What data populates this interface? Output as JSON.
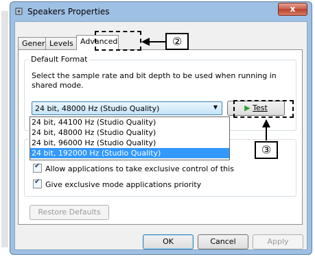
{
  "window": {
    "title": "Speakers Properties",
    "close_glyph": "x"
  },
  "tabs": [
    "General",
    "Levels",
    "Advanced"
  ],
  "default_format": {
    "legend": "Default Format",
    "description": "Select the sample rate and bit depth to be used when running in shared mode.",
    "selected": "24 bit, 48000 Hz (Studio Quality)",
    "options": [
      "24 bit, 44100 Hz (Studio Quality)",
      "24 bit, 48000 Hz (Studio Quality)",
      "24 bit, 96000 Hz (Studio Quality)",
      "24 bit, 192000 Hz (Studio Quality)"
    ],
    "highlighted_option": "24 bit, 192000 Hz (Studio Quality)",
    "test_label": "Test"
  },
  "exclusive": {
    "legend_fragment": "E",
    "allow_label": "Allow applications to take exclusive control of this",
    "priority_label": "Give exclusive mode applications priority"
  },
  "restore_label": "Restore Defaults",
  "footer": {
    "ok": "OK",
    "cancel": "Cancel",
    "apply": "Apply"
  },
  "callouts": {
    "advanced_marker": "②",
    "test_marker": "③"
  },
  "colors": {
    "accent": "#3399ff",
    "frame": "#9ec0e4",
    "close": "#c75a45"
  }
}
